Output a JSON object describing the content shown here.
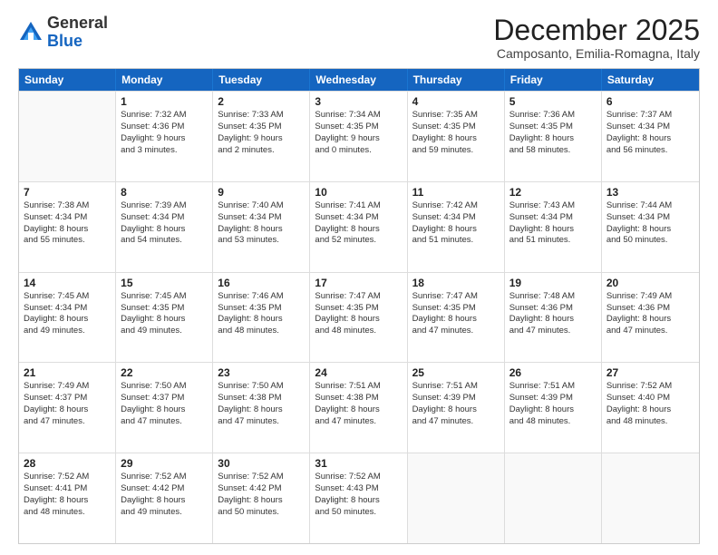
{
  "logo": {
    "general": "General",
    "blue": "Blue"
  },
  "header": {
    "month": "December 2025",
    "location": "Camposanto, Emilia-Romagna, Italy"
  },
  "days": [
    "Sunday",
    "Monday",
    "Tuesday",
    "Wednesday",
    "Thursday",
    "Friday",
    "Saturday"
  ],
  "weeks": [
    [
      {
        "day": "",
        "lines": []
      },
      {
        "day": "1",
        "lines": [
          "Sunrise: 7:32 AM",
          "Sunset: 4:36 PM",
          "Daylight: 9 hours",
          "and 3 minutes."
        ]
      },
      {
        "day": "2",
        "lines": [
          "Sunrise: 7:33 AM",
          "Sunset: 4:35 PM",
          "Daylight: 9 hours",
          "and 2 minutes."
        ]
      },
      {
        "day": "3",
        "lines": [
          "Sunrise: 7:34 AM",
          "Sunset: 4:35 PM",
          "Daylight: 9 hours",
          "and 0 minutes."
        ]
      },
      {
        "day": "4",
        "lines": [
          "Sunrise: 7:35 AM",
          "Sunset: 4:35 PM",
          "Daylight: 8 hours",
          "and 59 minutes."
        ]
      },
      {
        "day": "5",
        "lines": [
          "Sunrise: 7:36 AM",
          "Sunset: 4:35 PM",
          "Daylight: 8 hours",
          "and 58 minutes."
        ]
      },
      {
        "day": "6",
        "lines": [
          "Sunrise: 7:37 AM",
          "Sunset: 4:34 PM",
          "Daylight: 8 hours",
          "and 56 minutes."
        ]
      }
    ],
    [
      {
        "day": "7",
        "lines": [
          "Sunrise: 7:38 AM",
          "Sunset: 4:34 PM",
          "Daylight: 8 hours",
          "and 55 minutes."
        ]
      },
      {
        "day": "8",
        "lines": [
          "Sunrise: 7:39 AM",
          "Sunset: 4:34 PM",
          "Daylight: 8 hours",
          "and 54 minutes."
        ]
      },
      {
        "day": "9",
        "lines": [
          "Sunrise: 7:40 AM",
          "Sunset: 4:34 PM",
          "Daylight: 8 hours",
          "and 53 minutes."
        ]
      },
      {
        "day": "10",
        "lines": [
          "Sunrise: 7:41 AM",
          "Sunset: 4:34 PM",
          "Daylight: 8 hours",
          "and 52 minutes."
        ]
      },
      {
        "day": "11",
        "lines": [
          "Sunrise: 7:42 AM",
          "Sunset: 4:34 PM",
          "Daylight: 8 hours",
          "and 51 minutes."
        ]
      },
      {
        "day": "12",
        "lines": [
          "Sunrise: 7:43 AM",
          "Sunset: 4:34 PM",
          "Daylight: 8 hours",
          "and 51 minutes."
        ]
      },
      {
        "day": "13",
        "lines": [
          "Sunrise: 7:44 AM",
          "Sunset: 4:34 PM",
          "Daylight: 8 hours",
          "and 50 minutes."
        ]
      }
    ],
    [
      {
        "day": "14",
        "lines": [
          "Sunrise: 7:45 AM",
          "Sunset: 4:34 PM",
          "Daylight: 8 hours",
          "and 49 minutes."
        ]
      },
      {
        "day": "15",
        "lines": [
          "Sunrise: 7:45 AM",
          "Sunset: 4:35 PM",
          "Daylight: 8 hours",
          "and 49 minutes."
        ]
      },
      {
        "day": "16",
        "lines": [
          "Sunrise: 7:46 AM",
          "Sunset: 4:35 PM",
          "Daylight: 8 hours",
          "and 48 minutes."
        ]
      },
      {
        "day": "17",
        "lines": [
          "Sunrise: 7:47 AM",
          "Sunset: 4:35 PM",
          "Daylight: 8 hours",
          "and 48 minutes."
        ]
      },
      {
        "day": "18",
        "lines": [
          "Sunrise: 7:47 AM",
          "Sunset: 4:35 PM",
          "Daylight: 8 hours",
          "and 47 minutes."
        ]
      },
      {
        "day": "19",
        "lines": [
          "Sunrise: 7:48 AM",
          "Sunset: 4:36 PM",
          "Daylight: 8 hours",
          "and 47 minutes."
        ]
      },
      {
        "day": "20",
        "lines": [
          "Sunrise: 7:49 AM",
          "Sunset: 4:36 PM",
          "Daylight: 8 hours",
          "and 47 minutes."
        ]
      }
    ],
    [
      {
        "day": "21",
        "lines": [
          "Sunrise: 7:49 AM",
          "Sunset: 4:37 PM",
          "Daylight: 8 hours",
          "and 47 minutes."
        ]
      },
      {
        "day": "22",
        "lines": [
          "Sunrise: 7:50 AM",
          "Sunset: 4:37 PM",
          "Daylight: 8 hours",
          "and 47 minutes."
        ]
      },
      {
        "day": "23",
        "lines": [
          "Sunrise: 7:50 AM",
          "Sunset: 4:38 PM",
          "Daylight: 8 hours",
          "and 47 minutes."
        ]
      },
      {
        "day": "24",
        "lines": [
          "Sunrise: 7:51 AM",
          "Sunset: 4:38 PM",
          "Daylight: 8 hours",
          "and 47 minutes."
        ]
      },
      {
        "day": "25",
        "lines": [
          "Sunrise: 7:51 AM",
          "Sunset: 4:39 PM",
          "Daylight: 8 hours",
          "and 47 minutes."
        ]
      },
      {
        "day": "26",
        "lines": [
          "Sunrise: 7:51 AM",
          "Sunset: 4:39 PM",
          "Daylight: 8 hours",
          "and 48 minutes."
        ]
      },
      {
        "day": "27",
        "lines": [
          "Sunrise: 7:52 AM",
          "Sunset: 4:40 PM",
          "Daylight: 8 hours",
          "and 48 minutes."
        ]
      }
    ],
    [
      {
        "day": "28",
        "lines": [
          "Sunrise: 7:52 AM",
          "Sunset: 4:41 PM",
          "Daylight: 8 hours",
          "and 48 minutes."
        ]
      },
      {
        "day": "29",
        "lines": [
          "Sunrise: 7:52 AM",
          "Sunset: 4:42 PM",
          "Daylight: 8 hours",
          "and 49 minutes."
        ]
      },
      {
        "day": "30",
        "lines": [
          "Sunrise: 7:52 AM",
          "Sunset: 4:42 PM",
          "Daylight: 8 hours",
          "and 50 minutes."
        ]
      },
      {
        "day": "31",
        "lines": [
          "Sunrise: 7:52 AM",
          "Sunset: 4:43 PM",
          "Daylight: 8 hours",
          "and 50 minutes."
        ]
      },
      {
        "day": "",
        "lines": []
      },
      {
        "day": "",
        "lines": []
      },
      {
        "day": "",
        "lines": []
      }
    ]
  ]
}
